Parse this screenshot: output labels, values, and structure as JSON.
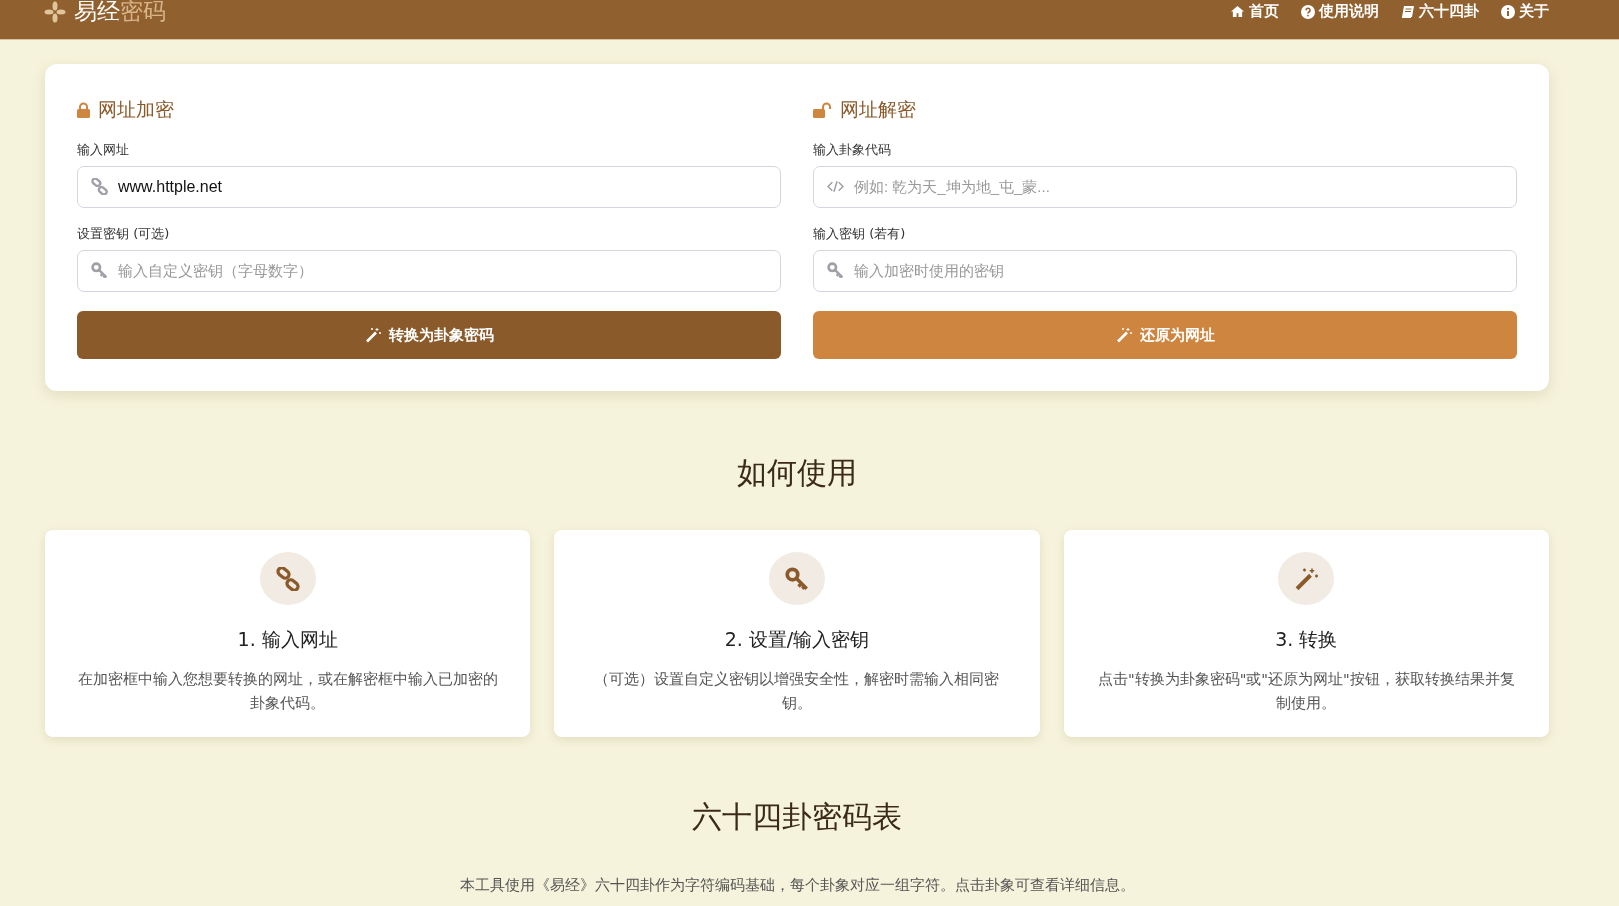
{
  "header": {
    "logo": {
      "main": "易经",
      "accent": "密码"
    },
    "nav": [
      {
        "label": "首页"
      },
      {
        "label": "使用说明"
      },
      {
        "label": "六十四卦"
      },
      {
        "label": "关于"
      }
    ]
  },
  "panels": [
    {
      "title": "网址加密",
      "fields": [
        {
          "label": "输入网址",
          "value": "www.httple.net"
        },
        {
          "label": "设置密钥 (可选)",
          "placeholder": "输入自定义密钥（字母数字）"
        }
      ],
      "button": {
        "label": "转换为卦象密码",
        "kind": "primary"
      }
    },
    {
      "title": "网址解密",
      "fields": [
        {
          "label": "输入卦象代码",
          "placeholder": "例如: 乾为天_坤为地_屯_蒙..."
        },
        {
          "label": "输入密钥 (若有)",
          "placeholder": "输入加密时使用的密钥"
        }
      ],
      "button": {
        "label": "还原为网址",
        "kind": "secondary"
      }
    }
  ],
  "how_to": {
    "title": "如何使用",
    "steps": [
      {
        "title": "1. 输入网址",
        "text": "在加密框中输入您想要转换的网址，或在解密框中输入已加密的卦象代码。"
      },
      {
        "title": "2. 设置/输入密钥",
        "text": "（可选）设置自定义密钥以增强安全性，解密时需输入相同密钥。"
      },
      {
        "title": "3. 转换",
        "text": "点击\"转换为卦象密码\"或\"还原为网址\"按钮，获取转换结果并复制使用。"
      }
    ]
  },
  "table_section": {
    "title": "六十四卦密码表",
    "intro": "本工具使用《易经》六十四卦作为字符编码基础，每个卦象对应一组字符。点击卦象可查看详细信息。"
  }
}
